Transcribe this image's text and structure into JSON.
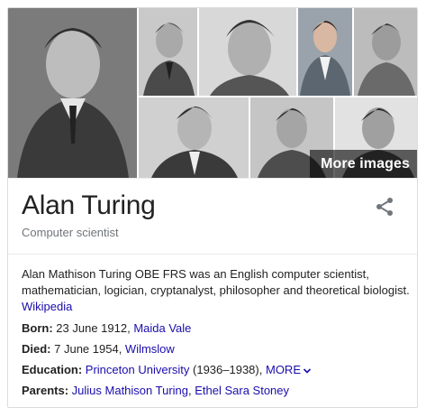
{
  "images": {
    "more_label": "More images"
  },
  "entity": {
    "title": "Alan Turing",
    "subtitle": "Computer scientist",
    "description": "Alan Mathison Turing OBE FRS was an English computer scientist, mathematician, logician, cryptanalyst, philosopher and theoretical biologist.",
    "source_link": "Wikipedia"
  },
  "facts": {
    "born": {
      "label": "Born:",
      "text": "23 June 1912, ",
      "link": "Maida Vale"
    },
    "died": {
      "label": "Died:",
      "text": "7 June 1954, ",
      "link": "Wilmslow"
    },
    "education": {
      "label": "Education:",
      "link": "Princeton University",
      "text": " (1936–1938), ",
      "more": "MORE"
    },
    "parents": {
      "label": "Parents:",
      "link1": "Julius Mathison Turing",
      "sep": ", ",
      "link2": "Ethel Sara Stoney"
    }
  },
  "colors": {
    "link": "#1a0dab",
    "text": "#222222",
    "muted": "#70757a",
    "border": "#dadce0"
  },
  "icons": {
    "share": "share-icon",
    "chevron": "chevron-down-icon"
  }
}
